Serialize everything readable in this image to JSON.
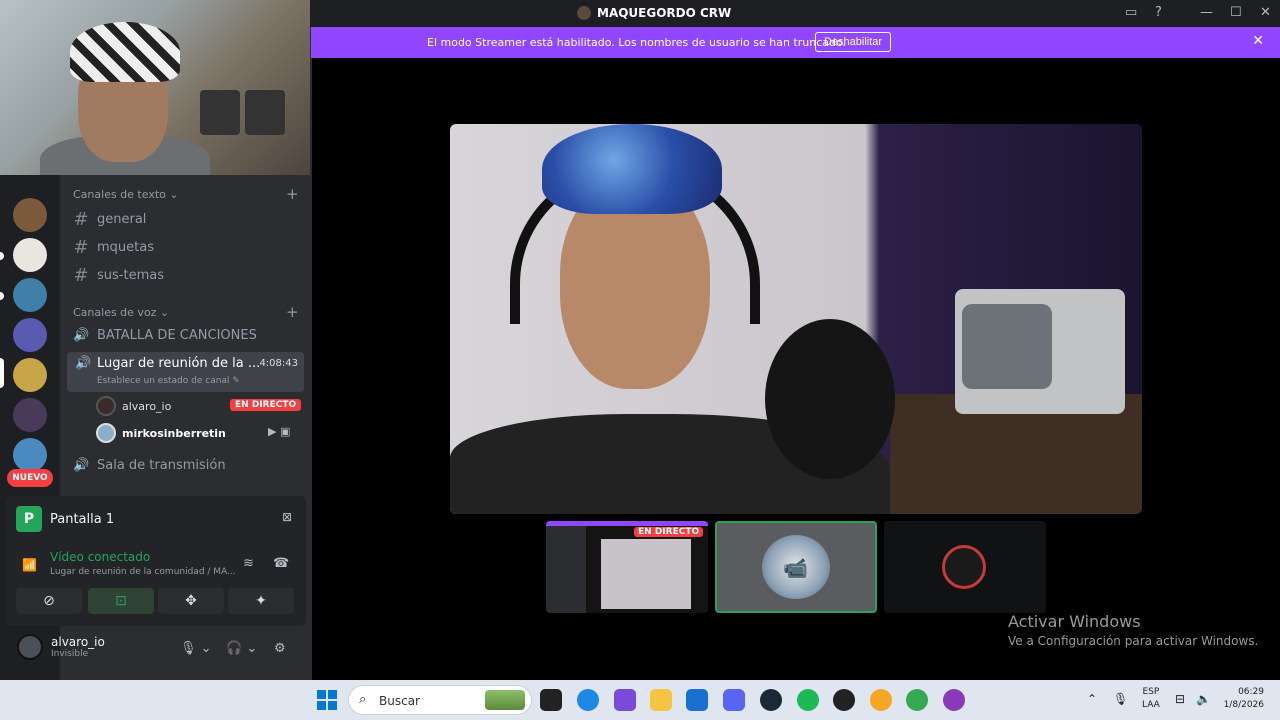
{
  "window": {
    "title": "MAQUEGORDO CRW",
    "controls": {
      "inbox": "▭",
      "help": "?",
      "minimize": "—",
      "maximize": "☐",
      "close": "✕"
    }
  },
  "banner": {
    "text": "El modo Streamer está habilitado. Los nombres de usuario se han truncado.",
    "button": "Deshabilitar",
    "close": "✕"
  },
  "rail": {
    "badge": "NUEVO"
  },
  "sidebar": {
    "text_category": "Canales de texto",
    "text_channels": [
      "general",
      "mquetas",
      "sus-temas"
    ],
    "voice_category": "Canales de voz",
    "voice_channels": {
      "battle": "BATALLA DE CANCIONES",
      "active": {
        "name": "Lugar de reunión de la ...",
        "time": "4:08:43",
        "status": "Establece un estado de canal"
      },
      "members": [
        {
          "name": "alvaro_io",
          "badge": "EN DIRECTO"
        },
        {
          "name": "mirkosinberretin"
        }
      ],
      "broadcast": "Sala de transmisión"
    }
  },
  "voice_panel": {
    "screen_icon_letter": "P",
    "screen_label": "Pantalla 1",
    "status_title": "Vídeo conectado",
    "status_sub": "Lugar de reunión de la comunidad / MA..."
  },
  "user": {
    "name": "alvaro_io",
    "status": "Invisible"
  },
  "stage": {
    "thumb_live": "EN DIRECTO",
    "activate_title": "Activar Windows",
    "activate_sub": "Ve a Configuración para activar Windows."
  },
  "taskbar": {
    "search_placeholder": "Buscar",
    "lang_top": "ESP",
    "lang_bottom": "LAA",
    "time": "06:29",
    "date": "1/8/2026"
  },
  "colors": {
    "accent_purple": "#9147ff",
    "online_green": "#23a55a",
    "live_red": "#f23f42"
  }
}
